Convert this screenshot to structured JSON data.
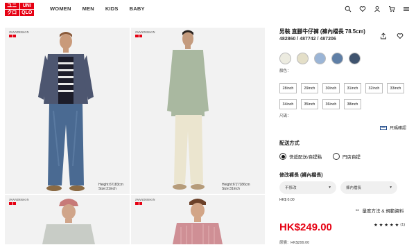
{
  "header": {
    "logo": [
      "ユニ",
      "UNI",
      "クロ",
      "QLO"
    ],
    "nav": [
      "WOMEN",
      "MEN",
      "KIDS",
      "BABY"
    ],
    "icons": [
      "search-icon",
      "heart-icon",
      "user-icon",
      "cart-icon",
      "menu-icon"
    ]
  },
  "gallery": {
    "brand": "JWANDERSON",
    "photos": [
      {
        "height_text": "Height:6'/183cm",
        "size_text": "Size:31inch"
      },
      {
        "height_text": "Height:6'1\"/186cm",
        "size_text": "Size:31inch"
      },
      {
        "height_text": "",
        "size_text": ""
      },
      {
        "height_text": "",
        "size_text": ""
      }
    ]
  },
  "product": {
    "title": "男裝 直腳牛仔褲 (褲內檔長 78.5cm)",
    "codes": "482860 / 487742 / 487206",
    "colors": [
      "#ecebe0",
      "#e4dfc8",
      "#9bb5d6",
      "#5f7fa6",
      "#3f536e"
    ],
    "color_label": "顏色：",
    "sizes": [
      "28inch",
      "29inch",
      "30inch",
      "31inch",
      "32inch",
      "33inch",
      "34inch",
      "35inch",
      "36inch",
      "38inch"
    ],
    "size_label": "尺碼：",
    "size_guide": "尺碼確認",
    "shipping_label": "配送方式",
    "shipping_options": [
      {
        "label": "快遞配送/自提點",
        "selected": true
      },
      {
        "label": "門店自提",
        "selected": false
      }
    ],
    "alter_label": "修改褲長 (褲內檔長)",
    "alter_select_1": "不修改",
    "alter_select_2": "褲內檔長",
    "alter_fee": "HK$ 0.00",
    "measure_link": "量度方法 & 規範資料",
    "price": "HK$249.00",
    "rating_stars": "★ ★ ★ ★ ★",
    "rating_count": "(1)",
    "original_price": "原價：HK$299.00"
  }
}
